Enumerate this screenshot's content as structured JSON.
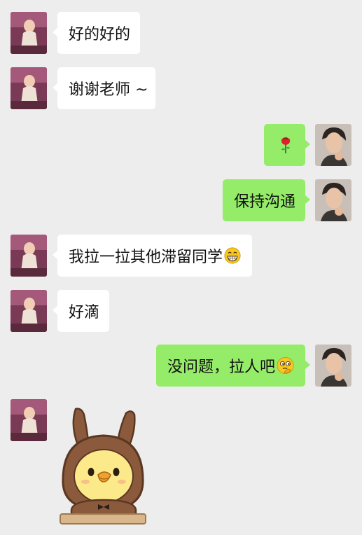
{
  "chat": {
    "messages": [
      {
        "side": "left",
        "text": "好的好的"
      },
      {
        "side": "left",
        "text": "谢谢老师 ~"
      },
      {
        "side": "right",
        "text": "",
        "icon": "rose-icon"
      },
      {
        "side": "right",
        "text": "保持沟通"
      },
      {
        "side": "left",
        "text": "我拉一拉其他滞留同学",
        "icon": "grin-emoji-icon"
      },
      {
        "side": "left",
        "text": "好滴"
      },
      {
        "side": "right",
        "text": "没问题，拉人吧",
        "icon": "thinking-emoji-icon"
      },
      {
        "side": "left",
        "sticker": "duck-in-bear-costume-sticker"
      }
    ]
  },
  "colors": {
    "background": "#ededed",
    "bubble_self": "#95ec69",
    "bubble_other": "#ffffff"
  }
}
